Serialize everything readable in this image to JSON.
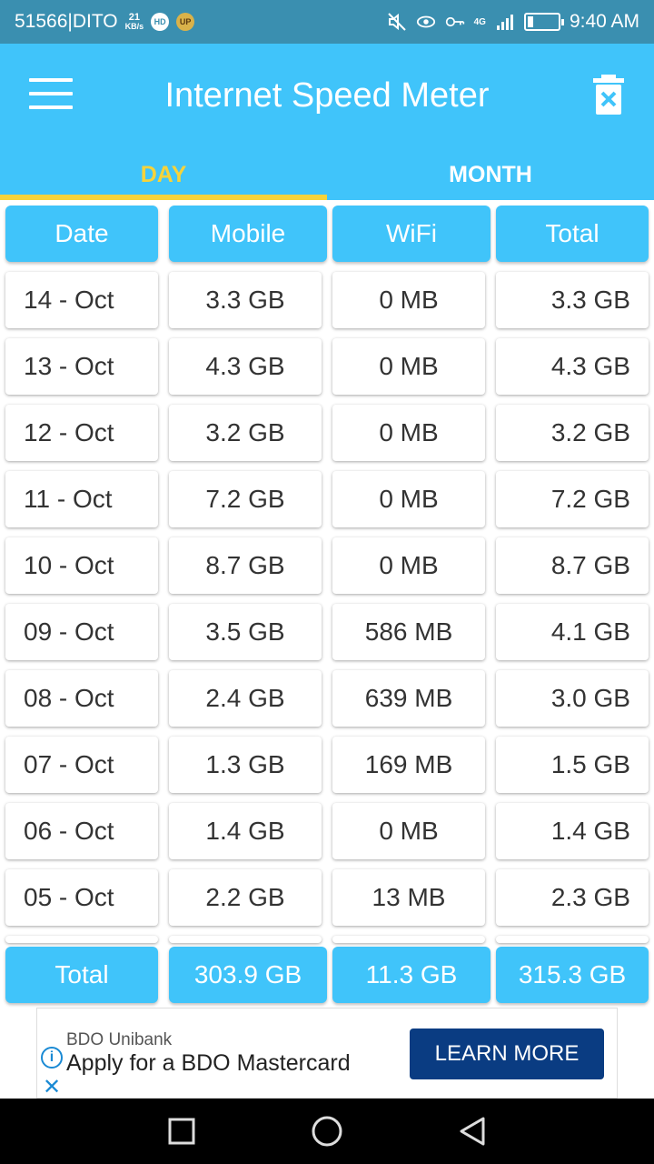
{
  "status_bar": {
    "carrier": "51566|DITO",
    "speed_value": "21",
    "speed_unit": "KB/s",
    "badge1": "HD",
    "badge2": "UP",
    "net_label": "4G",
    "time": "9:40 AM"
  },
  "app": {
    "title": "Internet Speed Meter",
    "tabs": [
      {
        "label": "DAY",
        "active": true
      },
      {
        "label": "MONTH",
        "active": false
      }
    ]
  },
  "table": {
    "headers": [
      "Date",
      "Mobile",
      "WiFi",
      "Total"
    ],
    "rows": [
      {
        "date": "14 - Oct",
        "mobile": "3.3 GB",
        "wifi": "0 MB",
        "total": "3.3 GB"
      },
      {
        "date": "13 - Oct",
        "mobile": "4.3 GB",
        "wifi": "0 MB",
        "total": "4.3 GB"
      },
      {
        "date": "12 - Oct",
        "mobile": "3.2 GB",
        "wifi": "0 MB",
        "total": "3.2 GB"
      },
      {
        "date": "11 - Oct",
        "mobile": "7.2 GB",
        "wifi": "0 MB",
        "total": "7.2 GB"
      },
      {
        "date": "10 - Oct",
        "mobile": "8.7 GB",
        "wifi": "0 MB",
        "total": "8.7 GB"
      },
      {
        "date": "09 - Oct",
        "mobile": "3.5 GB",
        "wifi": "586 MB",
        "total": "4.1 GB"
      },
      {
        "date": "08 - Oct",
        "mobile": "2.4 GB",
        "wifi": "639 MB",
        "total": "3.0 GB"
      },
      {
        "date": "07 - Oct",
        "mobile": "1.3 GB",
        "wifi": "169 MB",
        "total": "1.5 GB"
      },
      {
        "date": "06 - Oct",
        "mobile": "1.4 GB",
        "wifi": "0 MB",
        "total": "1.4 GB"
      },
      {
        "date": "05 - Oct",
        "mobile": "2.2 GB",
        "wifi": "13 MB",
        "total": "2.3 GB"
      }
    ],
    "totals": {
      "label": "Total",
      "mobile": "303.9 GB",
      "wifi": "11.3 GB",
      "total": "315.3 GB"
    }
  },
  "ad": {
    "brand": "BDO Unibank",
    "headline": "Apply for a BDO Mastercard",
    "cta": "LEARN MORE",
    "info_glyph": "i",
    "close_glyph": "✕"
  },
  "colors": {
    "accent": "#40c4fa",
    "tab_active": "#f6d33a",
    "cta": "#0a3c82"
  }
}
